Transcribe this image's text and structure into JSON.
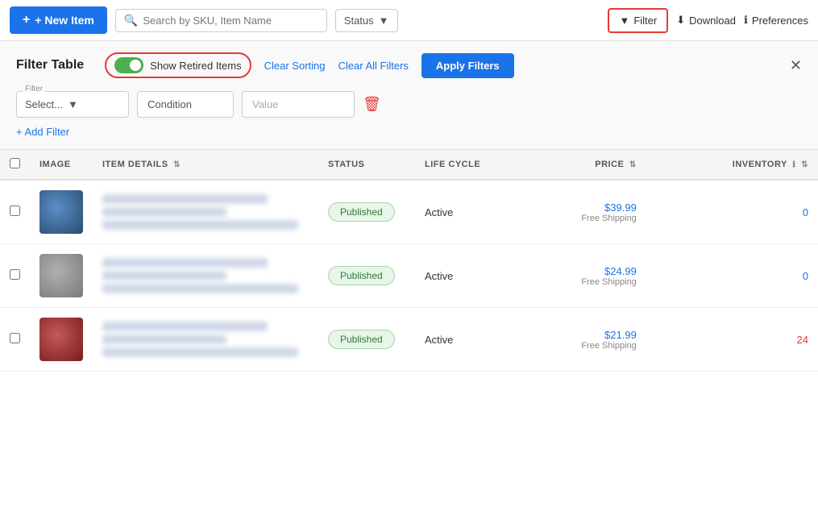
{
  "toolbar": {
    "new_item_label": "+ New Item",
    "search_placeholder": "Search by SKU, Item Name",
    "status_label": "Status",
    "filter_label": "Filter",
    "download_label": "Download",
    "preferences_label": "Preferences"
  },
  "filter_panel": {
    "title": "Filter Table",
    "toggle_label": "Show Retired Items",
    "clear_sorting_label": "Clear Sorting",
    "clear_all_filters_label": "Clear All Filters",
    "apply_filters_label": "Apply Filters",
    "filter_field_label": "Filter",
    "filter_select_placeholder": "Select...",
    "condition_label": "Condition",
    "value_label": "Value",
    "add_filter_label": "+ Add Filter"
  },
  "table": {
    "columns": {
      "image": "IMAGE",
      "item_details": "ITEM DETAILS",
      "status": "STATUS",
      "life_cycle": "LIFE CYCLE",
      "price": "PRICE",
      "inventory": "INVENTORY"
    },
    "rows": [
      {
        "id": 1,
        "image_class": "image-blue",
        "status": "Published",
        "life_cycle": "Active",
        "price": "$39.99",
        "free_shipping": "Free Shipping",
        "inventory": "0",
        "inventory_class": "inventory-zero"
      },
      {
        "id": 2,
        "image_class": "image-gray",
        "status": "Published",
        "life_cycle": "Active",
        "price": "$24.99",
        "free_shipping": "Free Shipping",
        "inventory": "0",
        "inventory_class": "inventory-zero"
      },
      {
        "id": 3,
        "image_class": "image-red",
        "status": "Published",
        "life_cycle": "Active",
        "price": "$21.99",
        "free_shipping": "Free Shipping",
        "inventory": "24",
        "inventory_class": "inventory-num"
      }
    ]
  }
}
